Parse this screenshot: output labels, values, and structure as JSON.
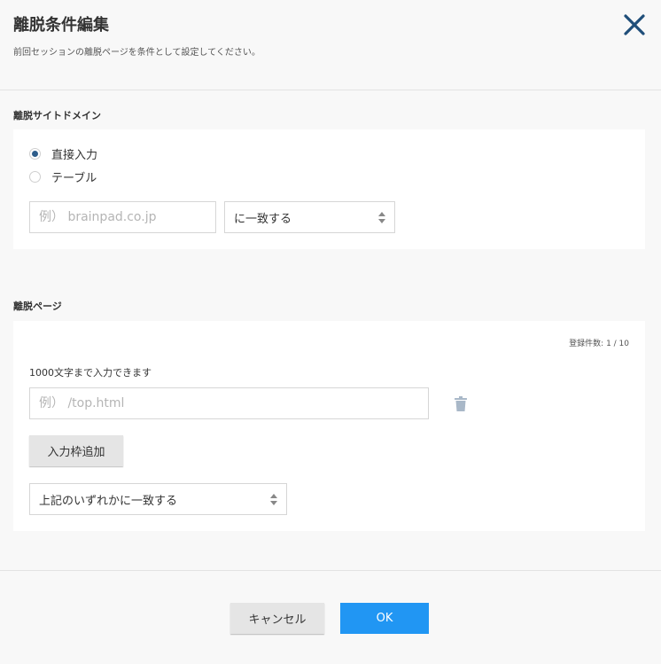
{
  "header": {
    "title": "離脱条件編集",
    "subtitle": "前回セッションの離脱ページを条件として設定してください。",
    "close_icon": "close-icon",
    "accent_color": "#1f4e79"
  },
  "domain_section": {
    "label": "離脱サイトドメイン",
    "radios": [
      {
        "label": "直接入力",
        "checked": true
      },
      {
        "label": "テーブル",
        "checked": false
      }
    ],
    "input_placeholder": "例） brainpad.co.jp",
    "input_value": "",
    "match_select": "に一致する"
  },
  "page_section": {
    "label": "離脱ページ",
    "counter": "登録件数: 1 / 10",
    "hint": "1000文字まで入力できます",
    "input_placeholder": "例） /top.html",
    "input_value": "",
    "add_button": "入力枠追加",
    "match_select": "上記のいずれかに一致する"
  },
  "footer": {
    "cancel_label": "キャンセル",
    "ok_label": "OK",
    "ok_color": "#2196f3"
  }
}
